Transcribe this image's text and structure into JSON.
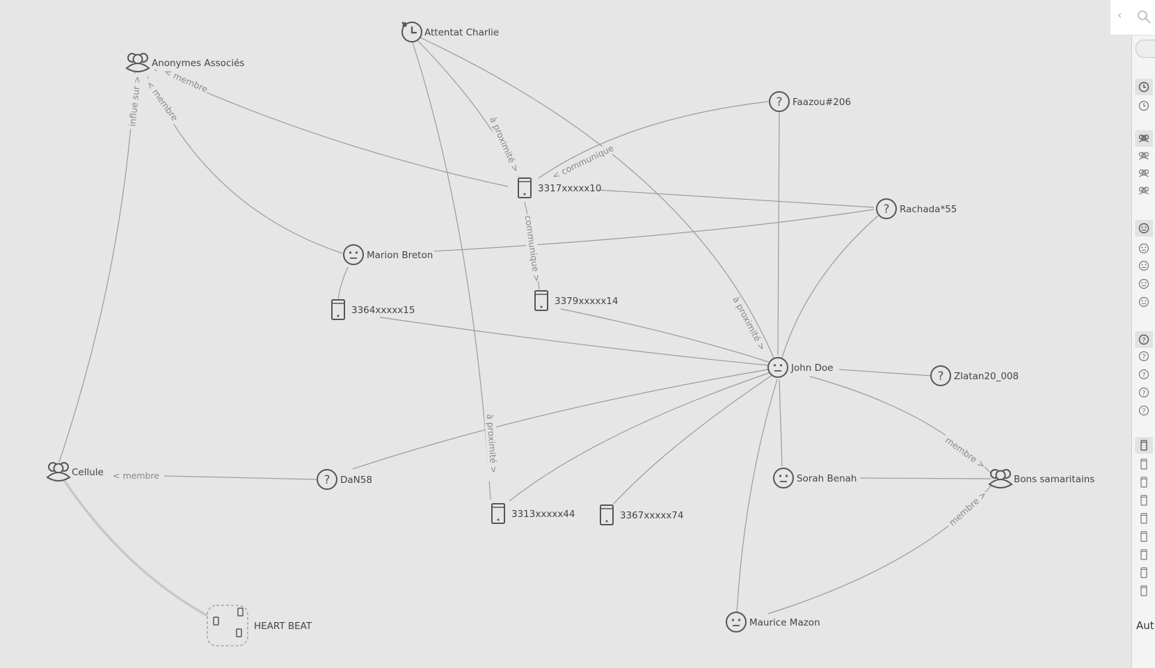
{
  "graph": {
    "nodes": {
      "attentat_charlie": "Attentat Charlie",
      "anonymes_associes": "Anonymes Associés",
      "faazou206": "Faazou#206",
      "phone_3317": "3317xxxxx10",
      "rachada55": "Rachada*55",
      "marion_breton": "Marion Breton",
      "phone_3364": "3364xxxxx15",
      "phone_3379": "3379xxxxx14",
      "john_doe": "John Doe",
      "zlatan20": "Zlatan20_008",
      "cellule": "Cellule",
      "dan58": "DaN58",
      "sorah_benah": "Sorah Benah",
      "bons_samaritains": "Bons samaritains",
      "phone_3313": "3313xxxxx44",
      "phone_3367": "3367xxxxx74",
      "maurice_mazon": "Maurice Mazon",
      "heart_beat": "HEART BEAT"
    },
    "edge_labels": {
      "anon_to_3317": "< membre",
      "anon_to_marion": "< membre",
      "cellule_to_anon": "influe sur >",
      "attentat_to_3317": "à proximité >",
      "faazou_to_3317": "< communique",
      "p3317_to_3379": "communique >",
      "attentat_to_john": "à proximité >",
      "cellule_to_dan": "< membre",
      "attentat_to_3313": "à proximité >",
      "john_to_bons": "membre >",
      "maurice_to_bons": "membre >"
    }
  },
  "right_panel": {
    "collapse_label": "‹",
    "bottom_text": "Aut"
  }
}
